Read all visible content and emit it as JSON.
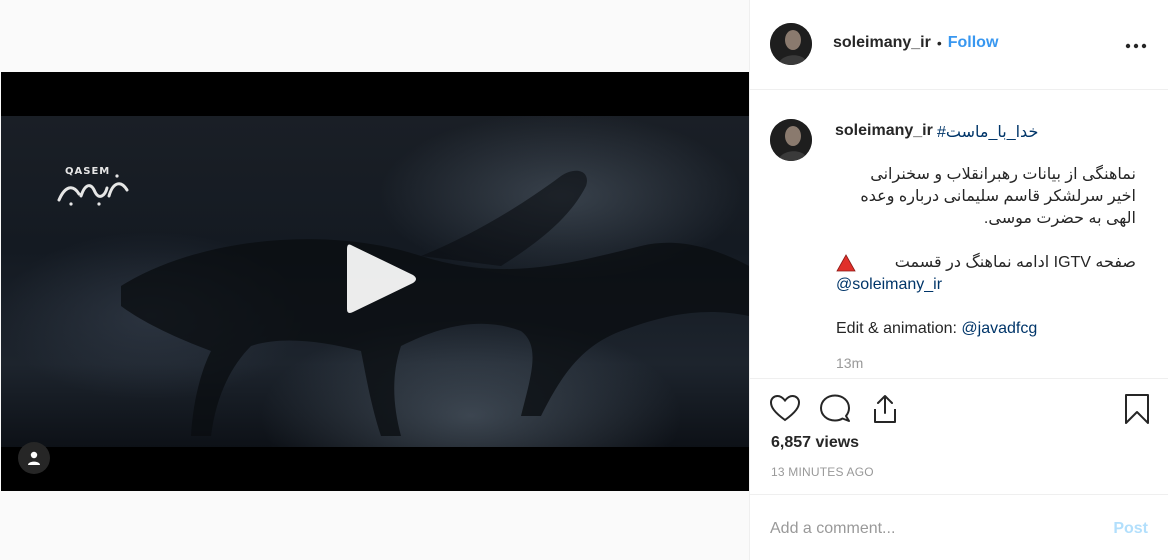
{
  "post": {
    "username": "soleimany_ir",
    "separator": "•",
    "follow_label": "Follow",
    "more_icon": "more-horizontal-icon"
  },
  "video": {
    "logo_text": "QASEM",
    "logo_script": "قاسم سلیمانی",
    "play_icon": "play-icon",
    "user_tag_icon": "user-icon"
  },
  "caption": {
    "username": "soleimany_ir",
    "hashtag": "#خدا_با_ماست",
    "line1": "نماهنگی از بیانات رهبرانقلاب و سخنرانی",
    "line2": "اخیر سرلشکر قاسم سلیمانی درباره وعده",
    "line3": "الهی به حضرت موسی.",
    "line4": "صفحه IGTV ادامه نماهنگ در قسمت",
    "line4_icon": "red-triangle-icon",
    "mention1": "@soleimany_ir",
    "edit_label": "Edit & animation: ",
    "mention2": "@javadfcg",
    "time": "13m"
  },
  "actions": {
    "like_icon": "heart-icon",
    "comment_icon": "comment-icon",
    "share_icon": "share-icon",
    "save_icon": "bookmark-icon"
  },
  "stats": {
    "views": "6,857 views",
    "time_ago": "13 MINUTES AGO"
  },
  "comment_box": {
    "placeholder": "Add a comment...",
    "post_label": "Post"
  },
  "colors": {
    "accent": "#3897f0",
    "post_disabled": "#b2dffc",
    "link": "#003569",
    "muted": "#999999"
  }
}
